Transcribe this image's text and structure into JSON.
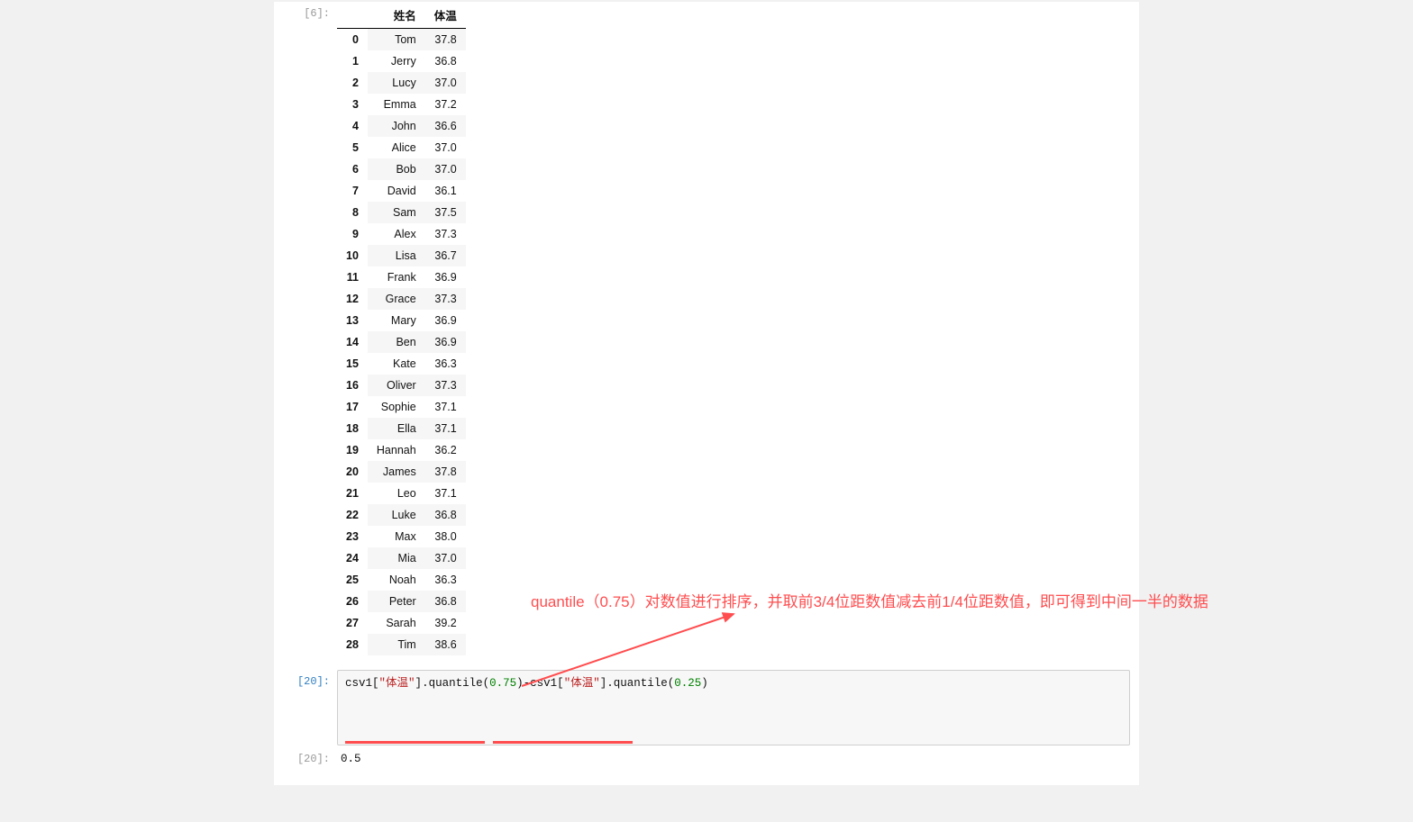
{
  "cell_output_prompt": "[6]:",
  "dataframe": {
    "columns": [
      "",
      "姓名",
      "体温"
    ],
    "rows": [
      {
        "idx": "0",
        "name": "Tom",
        "temp": "37.8"
      },
      {
        "idx": "1",
        "name": "Jerry",
        "temp": "36.8"
      },
      {
        "idx": "2",
        "name": "Lucy",
        "temp": "37.0"
      },
      {
        "idx": "3",
        "name": "Emma",
        "temp": "37.2"
      },
      {
        "idx": "4",
        "name": "John",
        "temp": "36.6"
      },
      {
        "idx": "5",
        "name": "Alice",
        "temp": "37.0"
      },
      {
        "idx": "6",
        "name": "Bob",
        "temp": "37.0"
      },
      {
        "idx": "7",
        "name": "David",
        "temp": "36.1"
      },
      {
        "idx": "8",
        "name": "Sam",
        "temp": "37.5"
      },
      {
        "idx": "9",
        "name": "Alex",
        "temp": "37.3"
      },
      {
        "idx": "10",
        "name": "Lisa",
        "temp": "36.7"
      },
      {
        "idx": "11",
        "name": "Frank",
        "temp": "36.9"
      },
      {
        "idx": "12",
        "name": "Grace",
        "temp": "37.3"
      },
      {
        "idx": "13",
        "name": "Mary",
        "temp": "36.9"
      },
      {
        "idx": "14",
        "name": "Ben",
        "temp": "36.9"
      },
      {
        "idx": "15",
        "name": "Kate",
        "temp": "36.3"
      },
      {
        "idx": "16",
        "name": "Oliver",
        "temp": "37.3"
      },
      {
        "idx": "17",
        "name": "Sophie",
        "temp": "37.1"
      },
      {
        "idx": "18",
        "name": "Ella",
        "temp": "37.1"
      },
      {
        "idx": "19",
        "name": "Hannah",
        "temp": "36.2"
      },
      {
        "idx": "20",
        "name": "James",
        "temp": "37.8"
      },
      {
        "idx": "21",
        "name": "Leo",
        "temp": "37.1"
      },
      {
        "idx": "22",
        "name": "Luke",
        "temp": "36.8"
      },
      {
        "idx": "23",
        "name": "Max",
        "temp": "38.0"
      },
      {
        "idx": "24",
        "name": "Mia",
        "temp": "37.0"
      },
      {
        "idx": "25",
        "name": "Noah",
        "temp": "36.3"
      },
      {
        "idx": "26",
        "name": "Peter",
        "temp": "36.8"
      },
      {
        "idx": "27",
        "name": "Sarah",
        "temp": "39.2"
      },
      {
        "idx": "28",
        "name": "Tim",
        "temp": "38.6"
      }
    ]
  },
  "code_cell": {
    "prompt_in": "[20]:",
    "prompt_out": "[20]:",
    "segments": {
      "s1": "csv1",
      "s2": "[",
      "s3": "\"体温\"",
      "s4": "]",
      "s5": ".",
      "s6": "quantile",
      "s7": "(",
      "s8": "0.75",
      "s9": ")",
      "s10": "-",
      "s11": "csv1",
      "s12": "[",
      "s13": "\"体温\"",
      "s14": "]",
      "s15": ".",
      "s16": "quantile",
      "s17": "(",
      "s18": "0.25",
      "s19": ")"
    },
    "output_value": "0.5"
  },
  "annotation_text": "quantile（0.75）对数值进行排序，并取前3/4位距数值减去前1/4位距数值，即可得到中间一半的数据",
  "colors": {
    "annotation_red": "#ff4d4f",
    "string_red": "#BA2121",
    "number_green": "#008000"
  }
}
